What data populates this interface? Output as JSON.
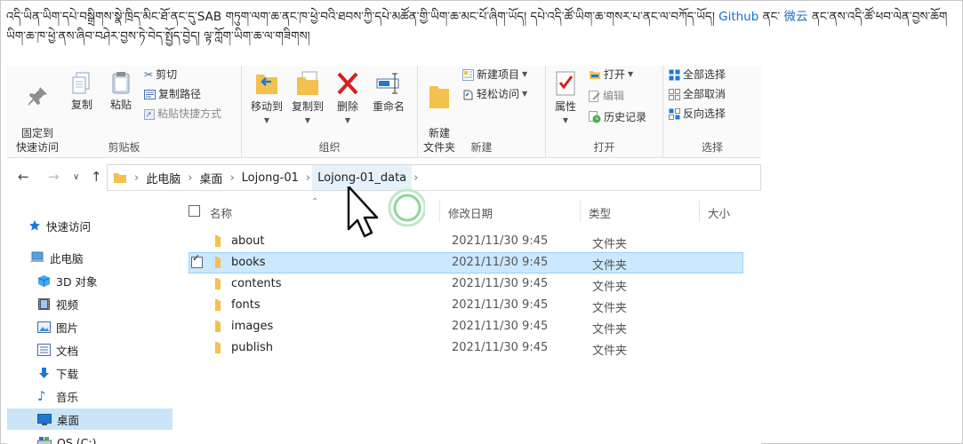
{
  "intro": {
    "text_before_sab": "འདི་ཡིན་ཡིག་དཔེ་བསྒྲིགས་སྣེ་ཁྲིད་མིང་ཐོ་ནང་དུ་",
    "sab": "SAB",
    "text_middle": " གཏུག་ལག་ཆ་ནང་ཁ་ཕྱེ་བའི་ཐབས་ཀྱི་དཔེ་མཚོན་གྱི་ཡིག་ཆ་མང་པོ་ཞིག་ཡོད། དཔེ་འདི་ཚོ་ཡིག་ཆ་གསར་པ་ནང་ལ་བཀོད་ཡོད། ",
    "link_github": "Github",
    "text_and": " ནང་ ",
    "link_weiyun": "微云",
    "text_after": " ནང་ནས་འདི་ཚོ་ཕབ་ལེན་བྱས་ཆོག ཡིག་ཆ་ཁ་ཕྱེ་ནས་ཞིབ་བཤེར་བྱས་ཏེ་བེད་སྤྱོད་བྱེད། ལྟ་ཀློག་ཡིག་ཆ་ལ་གཟིགས།"
  },
  "ribbon": {
    "clipboard": {
      "pin": "固定到\n快速访问",
      "copy": "复制",
      "paste": "粘贴",
      "cut": "剪切",
      "copy_path": "复制路径",
      "paste_shortcut": "粘贴快捷方式",
      "label": "剪贴板"
    },
    "organize": {
      "move_to": "移动到",
      "copy_to": "复制到",
      "delete": "删除",
      "rename": "重命名",
      "label": "组织"
    },
    "new": {
      "new_folder": "新建\n文件夹",
      "new_item": "新建项目",
      "easy_access": "轻松访问",
      "label": "新建"
    },
    "open": {
      "properties": "属性",
      "open": "打开",
      "edit": "编辑",
      "history": "历史记录",
      "label": "打开"
    },
    "select": {
      "select_all": "全部选择",
      "select_none": "全部取消",
      "invert": "反向选择",
      "label": "选择"
    }
  },
  "address": {
    "crumbs": [
      "此电脑",
      "桌面",
      "Lojong-01",
      "Lojong-01_data"
    ]
  },
  "sidebar": {
    "items": [
      {
        "label": "快速访问",
        "icon": "star-icon"
      },
      {
        "label": "此电脑",
        "icon": "computer-icon"
      },
      {
        "label": "3D 对象",
        "icon": "cube-icon"
      },
      {
        "label": "视频",
        "icon": "video-icon"
      },
      {
        "label": "图片",
        "icon": "picture-icon"
      },
      {
        "label": "文档",
        "icon": "document-icon"
      },
      {
        "label": "下载",
        "icon": "download-icon"
      },
      {
        "label": "音乐",
        "icon": "music-icon"
      },
      {
        "label": "桌面",
        "icon": "desktop-icon"
      },
      {
        "label": "OS (C:)",
        "icon": "drive-icon"
      }
    ]
  },
  "files": {
    "columns": {
      "name": "名称",
      "date": "修改日期",
      "type": "类型",
      "size": "大小"
    },
    "rows": [
      {
        "name": "about",
        "date": "2021/11/30 9:45",
        "type": "文件夹"
      },
      {
        "name": "books",
        "date": "2021/11/30 9:45",
        "type": "文件夹",
        "selected": true
      },
      {
        "name": "contents",
        "date": "2021/11/30 9:45",
        "type": "文件夹"
      },
      {
        "name": "fonts",
        "date": "2021/11/30 9:45",
        "type": "文件夹"
      },
      {
        "name": "images",
        "date": "2021/11/30 9:45",
        "type": "文件夹"
      },
      {
        "name": "publish",
        "date": "2021/11/30 9:45",
        "type": "文件夹"
      }
    ]
  },
  "colors": {
    "accent": "#1a6fc9",
    "selection": "#cce8ff",
    "folder": "#f2c14e"
  }
}
